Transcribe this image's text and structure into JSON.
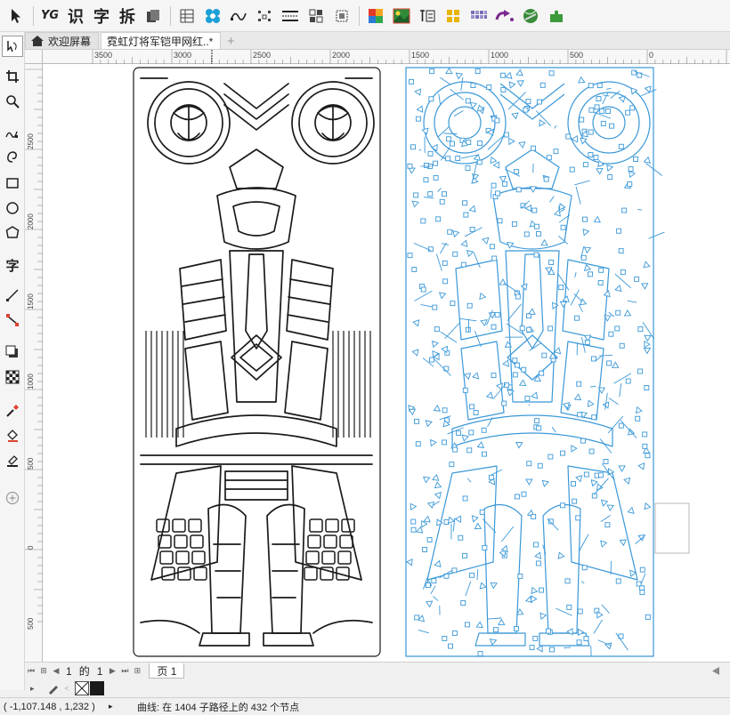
{
  "toolbar": {
    "font_label": "YG",
    "char_btn_1": "识",
    "char_btn_2": "字",
    "char_btn_3": "拆"
  },
  "tabs": [
    {
      "label": "欢迎屏幕"
    },
    {
      "label": "霓虹灯将军铠甲网红..*"
    }
  ],
  "tabs_add": "+",
  "tools": {
    "text_tool_label": "字"
  },
  "ruler_top": [
    "3500",
    "3000",
    "2500",
    "2000",
    "1500",
    "1000",
    "500",
    "0"
  ],
  "ruler_left": [
    "2500",
    "2000",
    "1500",
    "1000",
    "500",
    "0",
    "500"
  ],
  "pagenav": {
    "current": "1",
    "of": "的",
    "total": "1",
    "page_tab": "页 1"
  },
  "statusbar": {
    "coords": "( -1,107.148 , 1,232 )",
    "arrow": "▸",
    "info": "曲线: 在 1404 子路径上的 432 个节点"
  },
  "colors": {
    "accent_blue": "#3a98d8",
    "line_black": "#1a1a1a"
  }
}
